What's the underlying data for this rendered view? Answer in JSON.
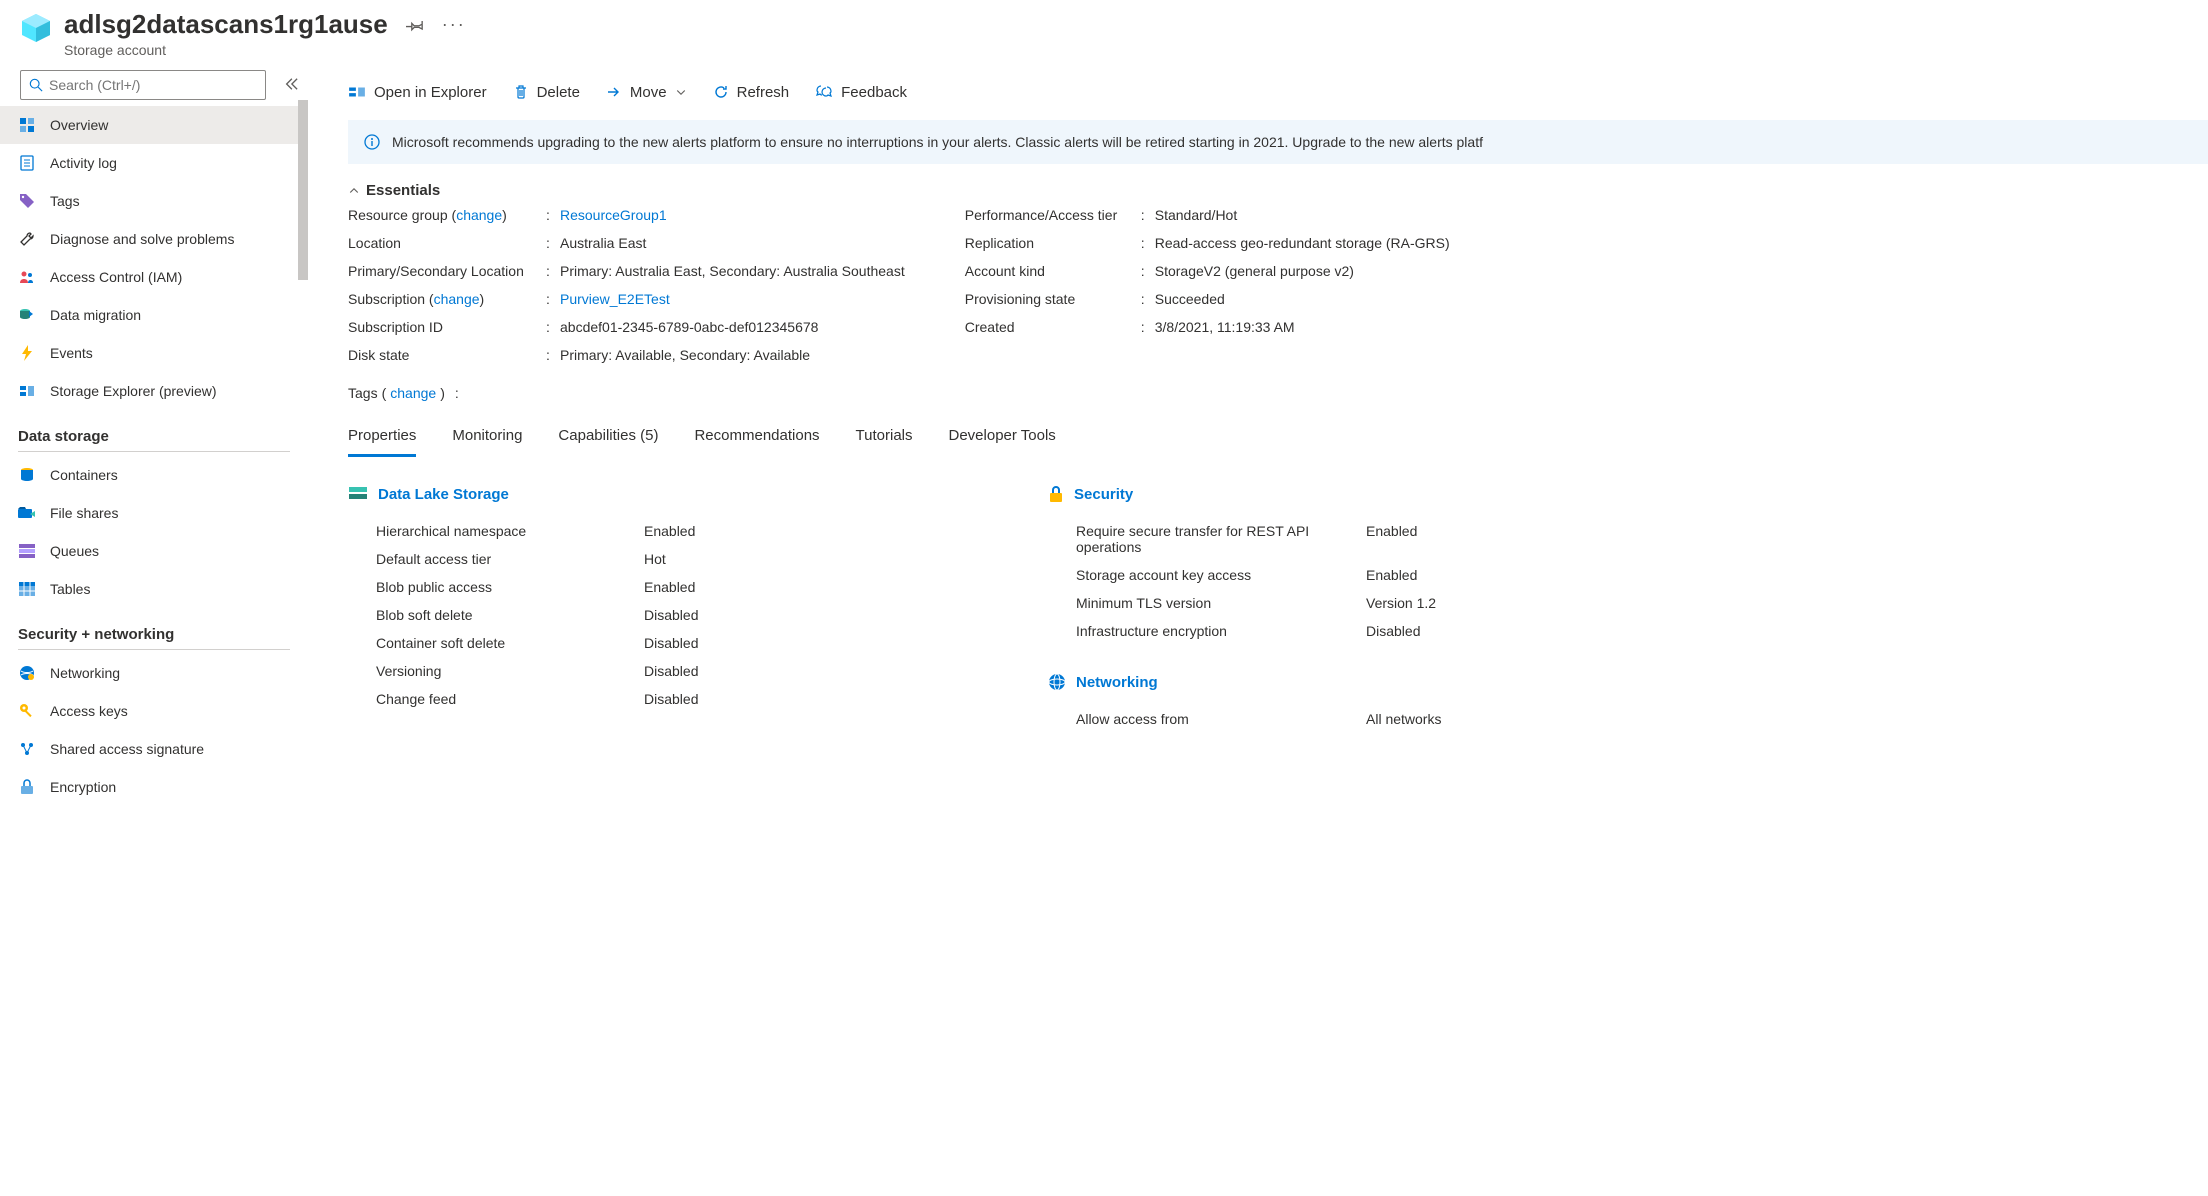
{
  "header": {
    "title": "adlsg2datascans1rg1ause",
    "subtitle": "Storage account"
  },
  "search": {
    "placeholder": "Search (Ctrl+/)"
  },
  "sidebar": {
    "items_top": [
      {
        "label": "Overview",
        "icon": "grid",
        "selected": true
      },
      {
        "label": "Activity log",
        "icon": "log"
      },
      {
        "label": "Tags",
        "icon": "tag"
      },
      {
        "label": "Diagnose and solve problems",
        "icon": "wrench"
      },
      {
        "label": "Access Control (IAM)",
        "icon": "people"
      },
      {
        "label": "Data migration",
        "icon": "db-arrow"
      },
      {
        "label": "Events",
        "icon": "bolt"
      },
      {
        "label": "Storage Explorer (preview)",
        "icon": "explorer"
      }
    ],
    "group_data_storage": "Data storage",
    "items_data": [
      {
        "label": "Containers",
        "icon": "container"
      },
      {
        "label": "File shares",
        "icon": "fileshare"
      },
      {
        "label": "Queues",
        "icon": "queue"
      },
      {
        "label": "Tables",
        "icon": "table"
      }
    ],
    "group_security": "Security + networking",
    "items_sec": [
      {
        "label": "Networking",
        "icon": "globe"
      },
      {
        "label": "Access keys",
        "icon": "key"
      },
      {
        "label": "Shared access signature",
        "icon": "sig"
      },
      {
        "label": "Encryption",
        "icon": "lock"
      }
    ]
  },
  "toolbar": {
    "open": "Open in Explorer",
    "delete": "Delete",
    "move": "Move",
    "refresh": "Refresh",
    "feedback": "Feedback"
  },
  "notice": "Microsoft recommends upgrading to the new alerts platform to ensure no interruptions in your alerts. Classic alerts will be retired starting in 2021. Upgrade to the new alerts platf",
  "essentials": {
    "heading": "Essentials",
    "left": {
      "resource_group_label": "Resource group",
      "resource_group_change": "change",
      "resource_group_value": "ResourceGroup1",
      "location_label": "Location",
      "location_value": "Australia East",
      "primary_loc_label": "Primary/Secondary Location",
      "primary_loc_value": "Primary: Australia East, Secondary: Australia Southeast",
      "subscription_label": "Subscription",
      "subscription_change": "change",
      "subscription_value": "Purview_E2ETest",
      "subid_label": "Subscription ID",
      "subid_value": "abcdef01-2345-6789-0abc-def012345678",
      "disk_label": "Disk state",
      "disk_value": "Primary: Available, Secondary: Available"
    },
    "right": {
      "perf_label": "Performance/Access tier",
      "perf_value": "Standard/Hot",
      "rep_label": "Replication",
      "rep_value": "Read-access geo-redundant storage (RA-GRS)",
      "kind_label": "Account kind",
      "kind_value": "StorageV2 (general purpose v2)",
      "prov_label": "Provisioning state",
      "prov_value": "Succeeded",
      "created_label": "Created",
      "created_value": "3/8/2021, 11:19:33 AM"
    },
    "tags_label": "Tags",
    "tags_change": "change"
  },
  "tabs": {
    "properties": "Properties",
    "monitoring": "Monitoring",
    "capabilities": "Capabilities (5)",
    "recommendations": "Recommendations",
    "tutorials": "Tutorials",
    "developer": "Developer Tools"
  },
  "props": {
    "dls_title": "Data Lake Storage",
    "dls": [
      {
        "label": "Hierarchical namespace",
        "value": "Enabled",
        "link": false
      },
      {
        "label": "Default access tier",
        "value": "Hot",
        "link": true
      },
      {
        "label": "Blob public access",
        "value": "Enabled",
        "link": true
      },
      {
        "label": "Blob soft delete",
        "value": "Disabled",
        "link": true
      },
      {
        "label": "Container soft delete",
        "value": "Disabled",
        "link": true
      },
      {
        "label": "Versioning",
        "value": "Disabled",
        "link": true
      },
      {
        "label": "Change feed",
        "value": "Disabled",
        "link": true
      }
    ],
    "sec_title": "Security",
    "sec": [
      {
        "label": "Require secure transfer for REST API operations",
        "value": "Enabled",
        "link": true
      },
      {
        "label": "Storage account key access",
        "value": "Enabled",
        "link": true
      },
      {
        "label": "Minimum TLS version",
        "value": "Version 1.2",
        "link": true
      },
      {
        "label": "Infrastructure encryption",
        "value": "Disabled",
        "link": true
      }
    ],
    "net_title": "Networking",
    "net": [
      {
        "label": "Allow access from",
        "value": "All networks",
        "link": true
      }
    ]
  }
}
